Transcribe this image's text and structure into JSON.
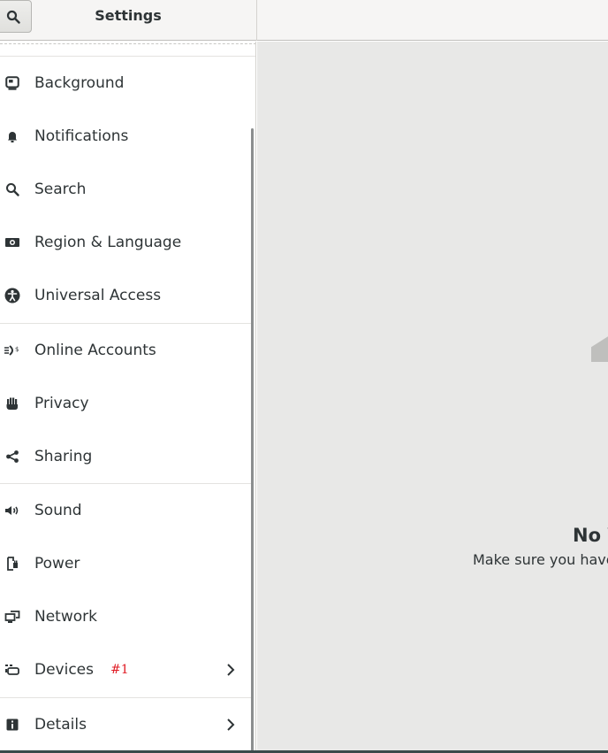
{
  "header": {
    "title": "Settings",
    "search_icon": "search-icon"
  },
  "sidebar": {
    "items": [
      {
        "label": "Background",
        "icon": "background-icon"
      },
      {
        "label": "Notifications",
        "icon": "bell-icon"
      },
      {
        "label": "Search",
        "icon": "search-icon"
      },
      {
        "label": "Region & Language",
        "icon": "camera-icon"
      },
      {
        "label": "Universal Access",
        "icon": "accessibility-icon"
      },
      {
        "label": "Online Accounts",
        "icon": "online-accounts-icon"
      },
      {
        "label": "Privacy",
        "icon": "hand-icon"
      },
      {
        "label": "Sharing",
        "icon": "share-icon"
      },
      {
        "label": "Sound",
        "icon": "speaker-icon"
      },
      {
        "label": "Power",
        "icon": "power-icon"
      },
      {
        "label": "Network",
        "icon": "network-icon"
      },
      {
        "label": "Devices",
        "icon": "devices-icon",
        "badge": "#1",
        "chevron": "chevron-right-icon"
      },
      {
        "label": "Details",
        "icon": "info-icon",
        "chevron": "chevron-right-icon"
      }
    ]
  },
  "main": {
    "empty_title": "No V",
    "empty_subtitle": "Make sure you have"
  },
  "colors": {
    "header_bg": "#f6f5f4",
    "main_bg": "#e8e8e7",
    "badge": "#e01b24",
    "text": "#2e3436"
  }
}
